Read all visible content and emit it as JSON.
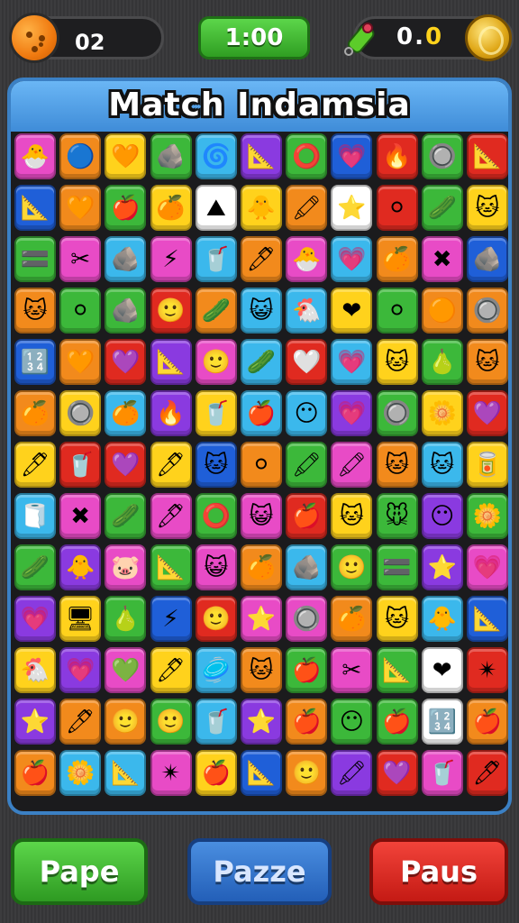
{
  "hud": {
    "left_counter": "02",
    "timer": "1:00",
    "score_prefix": "0.",
    "score_suffix": "0"
  },
  "board": {
    "title": "Match Indamsia"
  },
  "buttons": {
    "left": "Pape",
    "middle": "Pazze",
    "right": "Paus"
  },
  "colors": {
    "pink": "#e84bc6",
    "orange": "#f28a1c",
    "yellow": "#ffd21c",
    "green": "#3cb83a",
    "sky": "#3bb8ec",
    "purple": "#8a3ae0",
    "red": "#e02a20",
    "blue": "#1f5fd8",
    "white": "#ffffff",
    "lightgreen": "#8ed44a"
  },
  "tiles": [
    [
      [
        "pink",
        "🐣"
      ],
      [
        "orange",
        "🔵"
      ],
      [
        "yellow",
        "🧡"
      ],
      [
        "green",
        "🪨"
      ],
      [
        "sky",
        "🌀"
      ],
      [
        "purple",
        "📐"
      ],
      [
        "green",
        "⭕"
      ],
      [
        "blue",
        "💗"
      ],
      [
        "red",
        "🔥"
      ],
      [
        "green",
        "🔘"
      ],
      [
        "red",
        "📐"
      ]
    ],
    [
      [
        "blue",
        "📐"
      ],
      [
        "orange",
        "🧡"
      ],
      [
        "green",
        "🍎"
      ],
      [
        "yellow",
        "🍊"
      ],
      [
        "white",
        "⛰"
      ],
      [
        "yellow",
        "🐥"
      ],
      [
        "orange",
        "🖍"
      ],
      [
        "white",
        "⭐"
      ],
      [
        "red",
        "⚪"
      ],
      [
        "green",
        "🥒"
      ],
      [
        "yellow",
        "🐱"
      ]
    ],
    [
      [
        "green",
        "🟰"
      ],
      [
        "pink",
        "✂"
      ],
      [
        "sky",
        "🪨"
      ],
      [
        "pink",
        "⚡"
      ],
      [
        "sky",
        "🥤"
      ],
      [
        "orange",
        "🖊"
      ],
      [
        "pink",
        "🐣"
      ],
      [
        "sky",
        "💗"
      ],
      [
        "orange",
        "🍊"
      ],
      [
        "pink",
        "✖"
      ],
      [
        "blue",
        "🪨"
      ]
    ],
    [
      [
        "orange",
        "🐱"
      ],
      [
        "green",
        "⚪"
      ],
      [
        "green",
        "🪨"
      ],
      [
        "red",
        "🙂"
      ],
      [
        "orange",
        "🥒"
      ],
      [
        "sky",
        "😺"
      ],
      [
        "sky",
        "🐔"
      ],
      [
        "yellow",
        "❤"
      ],
      [
        "green",
        "⚪"
      ],
      [
        "orange",
        "🟠"
      ],
      [
        "orange",
        "🔘"
      ]
    ],
    [
      [
        "blue",
        "🔢"
      ],
      [
        "orange",
        "🧡"
      ],
      [
        "red",
        "💜"
      ],
      [
        "purple",
        "📐"
      ],
      [
        "pink",
        "🙂"
      ],
      [
        "sky",
        "🥒"
      ],
      [
        "red",
        "🤍"
      ],
      [
        "sky",
        "💗"
      ],
      [
        "yellow",
        "🐱"
      ],
      [
        "green",
        "🍐"
      ],
      [
        "orange",
        "🐱"
      ]
    ],
    [
      [
        "orange",
        "🍊"
      ],
      [
        "yellow",
        "🔘"
      ],
      [
        "sky",
        "🍊"
      ],
      [
        "purple",
        "🔥"
      ],
      [
        "yellow",
        "🥤"
      ],
      [
        "sky",
        "🍎"
      ],
      [
        "sky",
        "😶"
      ],
      [
        "purple",
        "💗"
      ],
      [
        "green",
        "🔘"
      ],
      [
        "yellow",
        "🌼"
      ],
      [
        "red",
        "💜"
      ]
    ],
    [
      [
        "yellow",
        "🖊"
      ],
      [
        "red",
        "🥤"
      ],
      [
        "red",
        "💜"
      ],
      [
        "yellow",
        "🖊"
      ],
      [
        "blue",
        "🐱"
      ],
      [
        "orange",
        "⚪"
      ],
      [
        "green",
        "🖍"
      ],
      [
        "pink",
        "🖍"
      ],
      [
        "orange",
        "🐱"
      ],
      [
        "sky",
        "🐱"
      ],
      [
        "yellow",
        "🥫"
      ]
    ],
    [
      [
        "sky",
        "🧻"
      ],
      [
        "pink",
        "✖"
      ],
      [
        "green",
        "🥒"
      ],
      [
        "pink",
        "🖊"
      ],
      [
        "green",
        "⭕"
      ],
      [
        "pink",
        "😺"
      ],
      [
        "red",
        "🍎"
      ],
      [
        "yellow",
        "🐱"
      ],
      [
        "green",
        "🐭"
      ],
      [
        "purple",
        "😶"
      ],
      [
        "green",
        "🌼"
      ]
    ],
    [
      [
        "green",
        "🥒"
      ],
      [
        "purple",
        "🐥"
      ],
      [
        "pink",
        "🐷"
      ],
      [
        "green",
        "📐"
      ],
      [
        "pink",
        "😺"
      ],
      [
        "orange",
        "🍊"
      ],
      [
        "sky",
        "🪨"
      ],
      [
        "green",
        "🙂"
      ],
      [
        "green",
        "🟰"
      ],
      [
        "purple",
        "⭐"
      ],
      [
        "pink",
        "💗"
      ]
    ],
    [
      [
        "purple",
        "💗"
      ],
      [
        "yellow",
        "🖥"
      ],
      [
        "green",
        "🍐"
      ],
      [
        "blue",
        "⚡"
      ],
      [
        "red",
        "🙂"
      ],
      [
        "pink",
        "⭐"
      ],
      [
        "pink",
        "🔘"
      ],
      [
        "orange",
        "🍊"
      ],
      [
        "yellow",
        "🐱"
      ],
      [
        "sky",
        "🐥"
      ],
      [
        "blue",
        "📐"
      ]
    ],
    [
      [
        "yellow",
        "🐔"
      ],
      [
        "purple",
        "💗"
      ],
      [
        "pink",
        "💚"
      ],
      [
        "yellow",
        "🖊"
      ],
      [
        "sky",
        "🥏"
      ],
      [
        "orange",
        "🐱"
      ],
      [
        "green",
        "🍎"
      ],
      [
        "pink",
        "✂"
      ],
      [
        "green",
        "📐"
      ],
      [
        "white",
        "❤"
      ],
      [
        "red",
        "✴"
      ]
    ],
    [
      [
        "purple",
        "⭐"
      ],
      [
        "orange",
        "🖊"
      ],
      [
        "orange",
        "🙂"
      ],
      [
        "green",
        "🙂"
      ],
      [
        "sky",
        "🥤"
      ],
      [
        "purple",
        "⭐"
      ],
      [
        "orange",
        "🍎"
      ],
      [
        "green",
        "😶"
      ],
      [
        "green",
        "🍎"
      ],
      [
        "white",
        "🔢"
      ],
      [
        "orange",
        "🍎"
      ]
    ],
    [
      [
        "orange",
        "🍎"
      ],
      [
        "sky",
        "🌼"
      ],
      [
        "sky",
        "📐"
      ],
      [
        "pink",
        "✴"
      ],
      [
        "yellow",
        "🍎"
      ],
      [
        "blue",
        "📐"
      ],
      [
        "orange",
        "🙂"
      ],
      [
        "purple",
        "🖍"
      ],
      [
        "red",
        "💜"
      ],
      [
        "pink",
        "🥤"
      ],
      [
        "red",
        "🖊"
      ]
    ]
  ]
}
